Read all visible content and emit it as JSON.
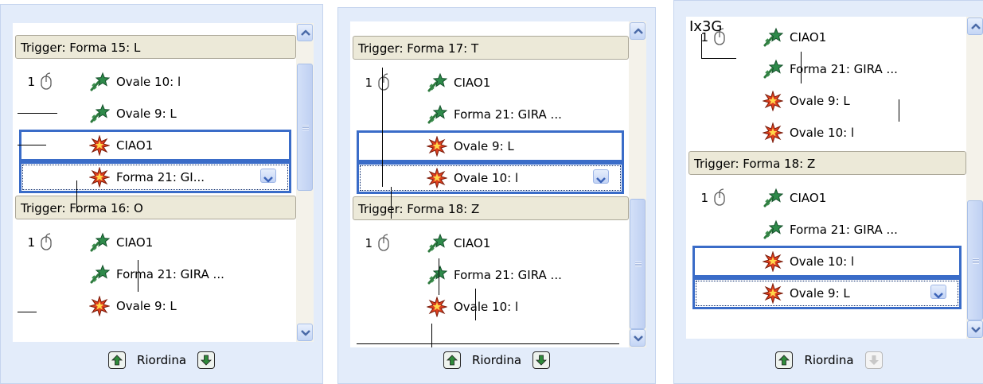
{
  "panels": [
    {
      "scroll": {
        "thumb_top": 0.08,
        "thumb_size": 0.45
      },
      "items": [
        {
          "kind": "header",
          "text": "Trigger: Forma 15: L"
        },
        {
          "kind": "row",
          "num": "1",
          "mouse": true,
          "effect": "entrance",
          "label": "Ovale 10: l"
        },
        {
          "kind": "row",
          "effect": "entrance",
          "label": "Ovale 9: L"
        },
        {
          "kind": "row",
          "effect": "emphasis",
          "label": "CIAO1",
          "selected": true
        },
        {
          "kind": "row",
          "effect": "emphasis",
          "label": "Forma 21: GI...",
          "selected": true,
          "focused": true,
          "dropdown": true
        },
        {
          "kind": "header",
          "text": "Trigger: Forma 16: O"
        },
        {
          "kind": "row",
          "num": "1",
          "mouse": true,
          "effect": "entrance",
          "label": "CIAO1"
        },
        {
          "kind": "row",
          "effect": "entrance",
          "label": "Forma 21: GIRA ..."
        },
        {
          "kind": "row",
          "effect": "emphasis",
          "label": "Ovale 9: L"
        }
      ],
      "footer": {
        "label": "Riordina",
        "up_enabled": true,
        "down_enabled": true
      }
    },
    {
      "scroll": {
        "thumb_top": 0.55,
        "thumb_size": 0.45
      },
      "items": [
        {
          "kind": "header",
          "text": "Trigger: Forma 17: T"
        },
        {
          "kind": "row",
          "num": "1",
          "mouse": true,
          "effect": "entrance",
          "label": "CIAO1"
        },
        {
          "kind": "row",
          "effect": "entrance",
          "label": "Forma 21: GIRA ..."
        },
        {
          "kind": "row",
          "effect": "emphasis",
          "label": "Ovale 9: L",
          "selected": true
        },
        {
          "kind": "row",
          "effect": "emphasis",
          "label": "Ovale 10: l",
          "selected": true,
          "focused": true,
          "dropdown": true
        },
        {
          "kind": "header",
          "text": "Trigger: Forma 18: Z"
        },
        {
          "kind": "row",
          "num": "1",
          "mouse": true,
          "effect": "entrance",
          "label": "CIAO1"
        },
        {
          "kind": "row",
          "effect": "entrance",
          "label": "Forma 21: GIRA ..."
        },
        {
          "kind": "row",
          "effect": "emphasis",
          "label": "Ovale 10: l"
        }
      ],
      "footer": {
        "label": "Riordina",
        "up_enabled": true,
        "down_enabled": true
      }
    },
    {
      "scroll": {
        "thumb_top": 0.58,
        "thumb_size": 0.42
      },
      "items": [
        {
          "kind": "row",
          "num": "1",
          "mouse": true,
          "effect": "entrance",
          "label": "CIAO1"
        },
        {
          "kind": "row",
          "effect": "entrance",
          "label": "Forma 21: GIRA ..."
        },
        {
          "kind": "row",
          "effect": "emphasis",
          "label": "Ovale 9: L"
        },
        {
          "kind": "row",
          "effect": "emphasis",
          "label": "Ovale 10: l"
        },
        {
          "kind": "header",
          "text": "Trigger: Forma 18: Z"
        },
        {
          "kind": "row",
          "num": "1",
          "mouse": true,
          "effect": "entrance",
          "label": "CIAO1"
        },
        {
          "kind": "row",
          "effect": "entrance",
          "label": "Forma 21: GIRA ..."
        },
        {
          "kind": "row",
          "effect": "emphasis",
          "label": "Ovale 10: l",
          "selected": true
        },
        {
          "kind": "row",
          "effect": "emphasis",
          "label": "Ovale 9: L",
          "selected": true,
          "focused": true,
          "dropdown": true
        }
      ],
      "footer": {
        "label": "Riordina",
        "up_enabled": true,
        "down_enabled": false
      }
    }
  ],
  "artifact_text": "Ix3G",
  "colors": {
    "selection_border": "#3a6cc8",
    "header_bg": "#ece9d8",
    "panel_bg": "#e3ecfa",
    "entrance_star": "#2e8a4a",
    "emphasis_star": "#e04020"
  }
}
